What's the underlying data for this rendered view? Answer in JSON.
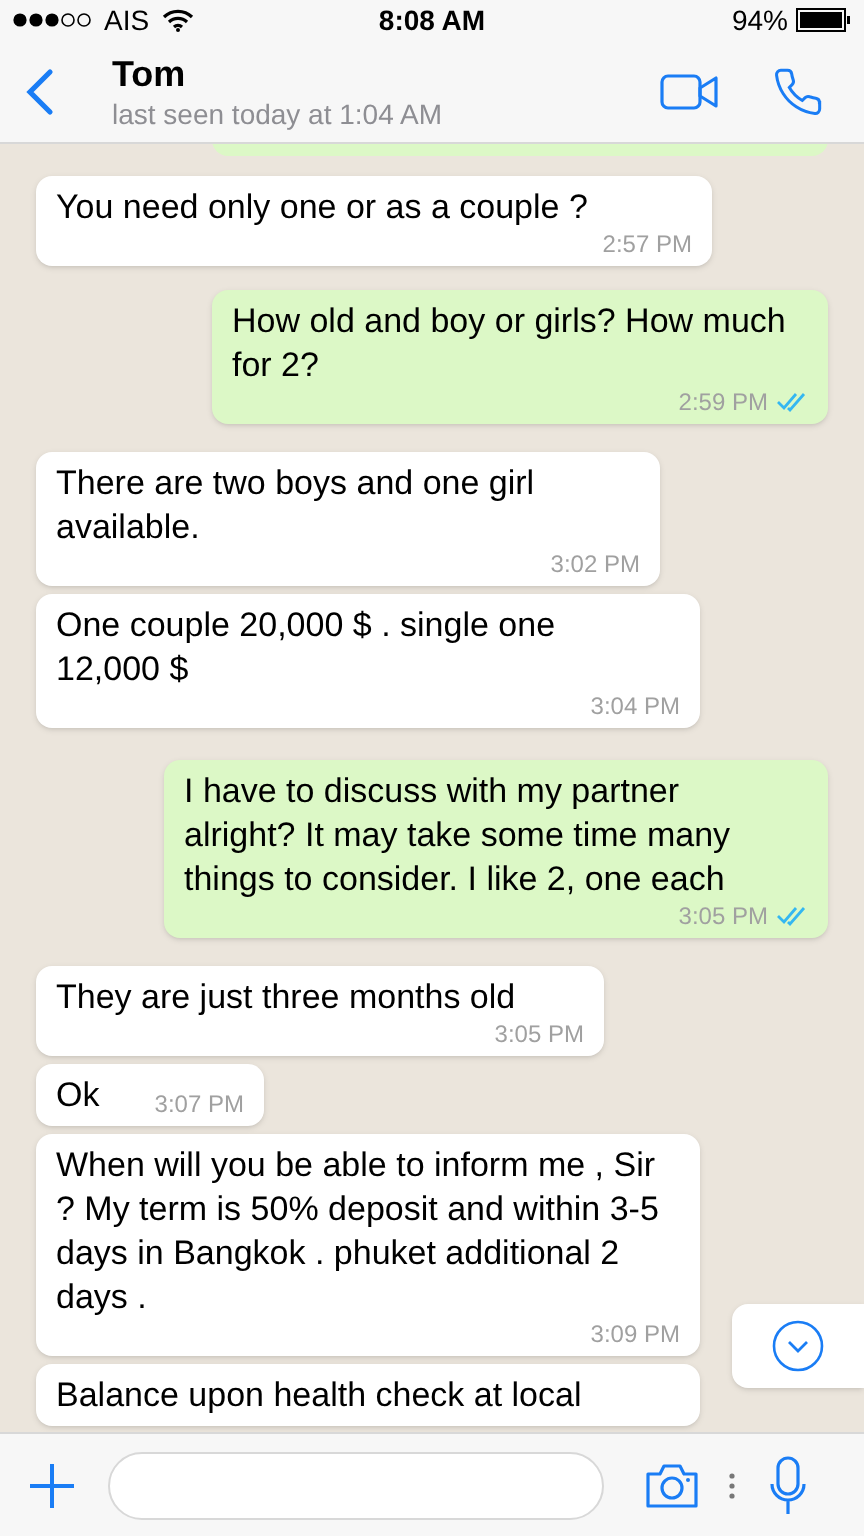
{
  "status_bar": {
    "carrier": "AIS",
    "time": "8:08 AM",
    "battery": "94%"
  },
  "header": {
    "name": "Tom",
    "last_seen": "last seen today at 1:04 AM"
  },
  "messages": [
    {
      "kind": "incoming",
      "text": "You need only one or as a couple ?",
      "time": "2:57 PM"
    },
    {
      "kind": "outgoing",
      "text": "How old and boy or girls? How much for 2?",
      "time": "2:59 PM",
      "read": true
    },
    {
      "kind": "incoming",
      "text": "There are two boys and one girl available.",
      "time": "3:02 PM"
    },
    {
      "kind": "incoming",
      "text": "One couple 20,000 $ . single one 12,000 $",
      "time": "3:04 PM"
    },
    {
      "kind": "outgoing",
      "text": "I have to discuss with my partner alright? It may take some time many things to consider. I like 2, one each",
      "time": "3:05 PM",
      "read": true
    },
    {
      "kind": "incoming",
      "text": "They are just three months old",
      "time": "3:05 PM"
    },
    {
      "kind": "incoming",
      "text": "Ok",
      "time": "3:07 PM"
    },
    {
      "kind": "incoming",
      "text": "When will you be able to inform me , Sir ? My term is 50% deposit and within 3-5 days in Bangkok . phuket additional 2 days .",
      "time": "3:09 PM"
    },
    {
      "kind": "incoming",
      "text": "Balance upon health check at local"
    }
  ]
}
